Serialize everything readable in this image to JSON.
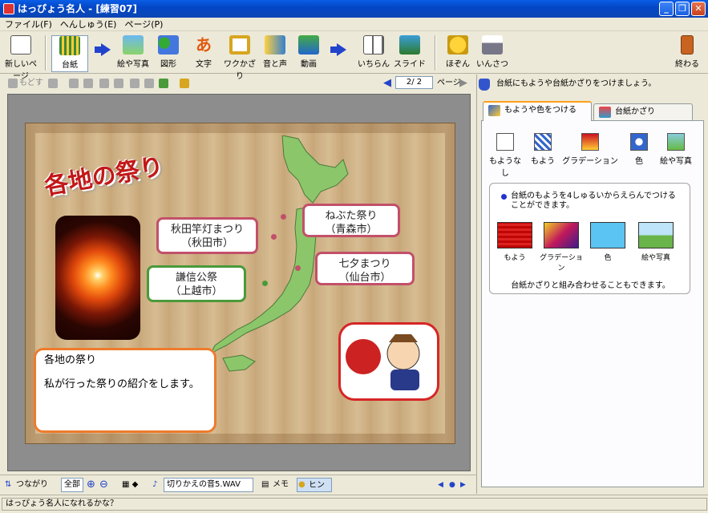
{
  "window": {
    "title": "はっぴょう名人 - [練習07]"
  },
  "menu": [
    "ファイル(F)",
    "へんしゅう(E)",
    "ページ(P)"
  ],
  "toolbar": {
    "new_page": "新しいページ",
    "items": [
      "台紙",
      "絵や写真",
      "図形",
      "文字",
      "ワクかざり",
      "音と声",
      "動画",
      "いちらん",
      "スライド",
      "ほぞん",
      "いんさつ"
    ],
    "quit": "終わる"
  },
  "edit_toolbar": {
    "undo": "もどす",
    "page_display": "2/ 2",
    "page_label": "ページ"
  },
  "slide": {
    "title": "各地の祭り",
    "labels": [
      {
        "line1": "ねぶた祭り",
        "line2": "（青森市）"
      },
      {
        "line1": "秋田竿灯まつり",
        "line2": "（秋田市）"
      },
      {
        "line1": "七夕まつり",
        "line2": "（仙台市）"
      },
      {
        "line1": "謙信公祭",
        "line2": "（上越市）"
      }
    ],
    "memo": {
      "heading": "各地の祭り",
      "body": "私が行った祭りの紹介をします。"
    }
  },
  "bottom_bar": {
    "link": "つながり",
    "zoom": "全部",
    "sound_file": "切りかえの音5.WAV",
    "memo": "メモ",
    "hint": "ヒント"
  },
  "panel": {
    "header": "台紙にもようや台紙かざりをつけましょう。",
    "tabs": [
      "もようや色をつける",
      "台紙かざり"
    ],
    "options": [
      "もようなし",
      "もよう",
      "グラデーション",
      "色",
      "絵や写真"
    ],
    "info": {
      "text": "台紙のもようを4しゅるいからえらんでつけることができます。",
      "swatches": [
        "もよう",
        "グラデーション",
        "色",
        "絵や写真"
      ],
      "footer": "台紙かざりと組み合わせることもできます。"
    }
  },
  "status": "はっぴょう名人になれるかな？"
}
